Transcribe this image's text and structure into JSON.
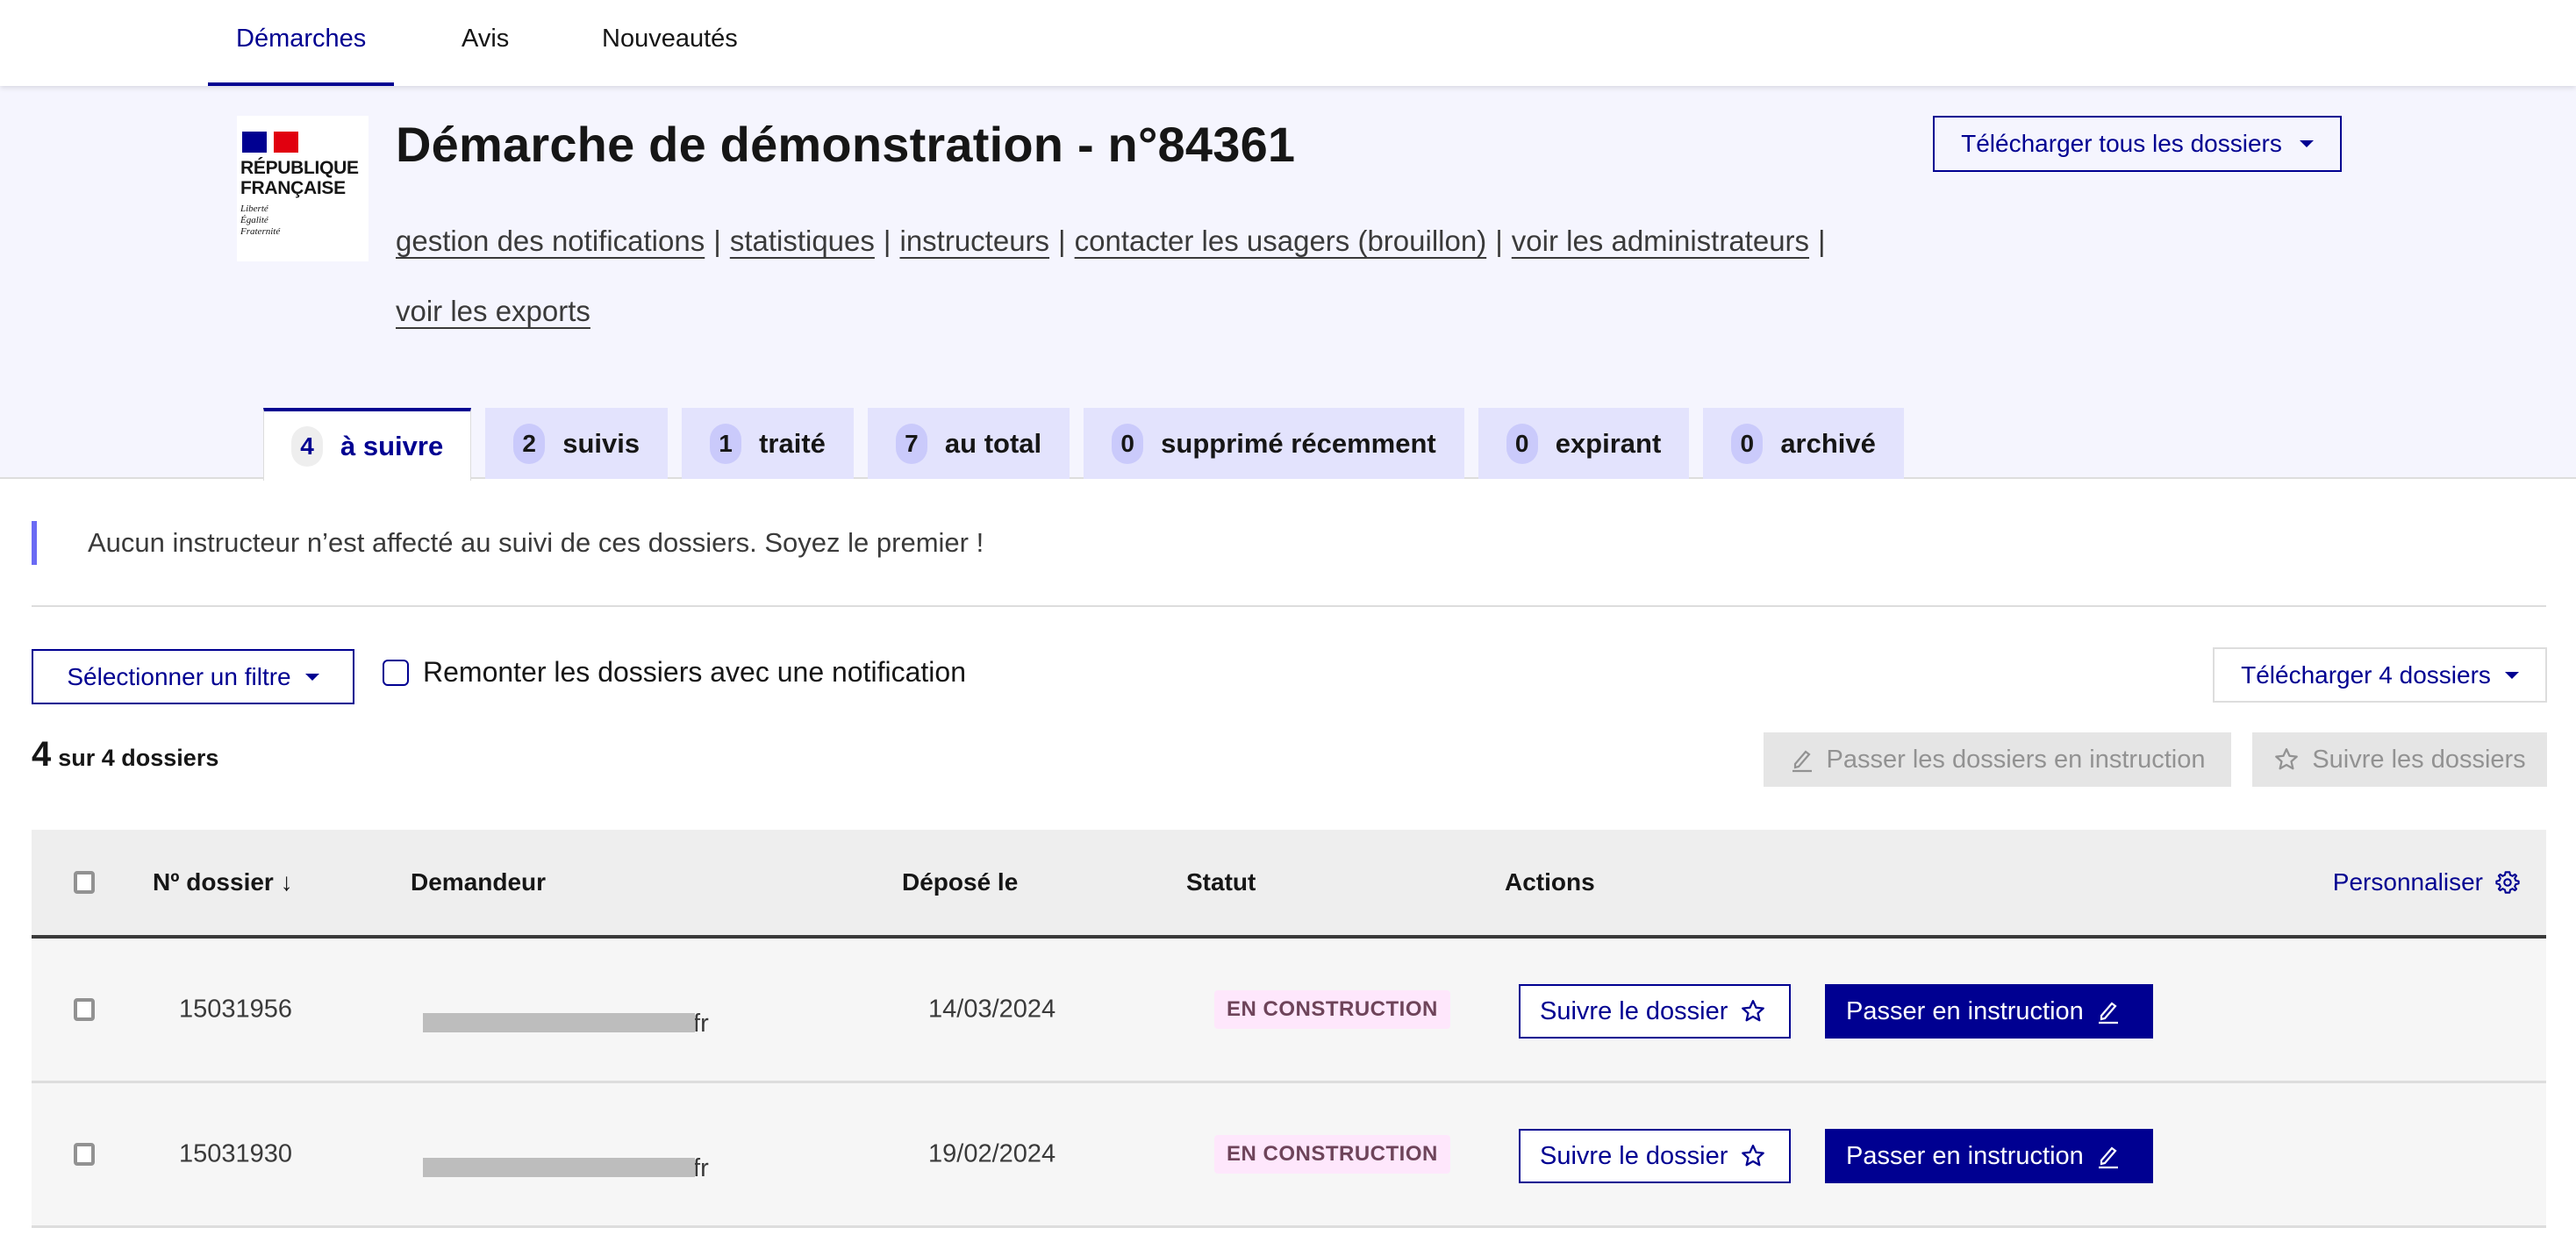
{
  "topnav": {
    "items": [
      {
        "label": "Démarches",
        "active": true
      },
      {
        "label": "Avis",
        "active": false
      },
      {
        "label": "Nouveautés",
        "active": false
      }
    ]
  },
  "header": {
    "logo": {
      "line1": "RÉPUBLIQUE",
      "line2": "FRANÇAISE",
      "motto1": "Liberté",
      "motto2": "Égalité",
      "motto3": "Fraternité"
    },
    "title": "Démarche de démonstration - n°84361",
    "download_all_label": "Télécharger tous les dossiers",
    "links": [
      "gestion des notifications",
      "statistiques",
      "instructeurs",
      "contacter les usagers (brouillon)",
      "voir les administrateurs",
      "voir les exports"
    ],
    "separator": "|"
  },
  "tabs": [
    {
      "count": "4",
      "label": "à suivre",
      "active": true
    },
    {
      "count": "2",
      "label": "suivis",
      "active": false
    },
    {
      "count": "1",
      "label": "traité",
      "active": false
    },
    {
      "count": "7",
      "label": "au total",
      "active": false
    },
    {
      "count": "0",
      "label": "supprimé récemment",
      "active": false
    },
    {
      "count": "0",
      "label": "expirant",
      "active": false
    },
    {
      "count": "0",
      "label": "archivé",
      "active": false
    }
  ],
  "notice": "Aucun instructeur n’est affecté au suivi de ces dossiers. Soyez le premier !",
  "filters": {
    "select_filter_label": "Sélectionner un filtre",
    "notification_checkbox_label": "Remonter les dossiers avec une notification",
    "notification_checked": false,
    "download_label": "Télécharger 4 dossiers"
  },
  "summary": {
    "count": "4",
    "text": "sur 4 dossiers"
  },
  "bulk_actions": {
    "instruct_label": "Passer les dossiers en instruction",
    "follow_label": "Suivre les dossiers"
  },
  "table": {
    "columns": {
      "number": "Nº dossier ↓",
      "applicant": "Demandeur",
      "date": "Déposé le",
      "status": "Statut",
      "actions": "Actions",
      "customize": "Personnaliser"
    },
    "rows": [
      {
        "number": "15031956",
        "applicant_visible": ".fr",
        "applicant_redacted": true,
        "date": "14/03/2024",
        "status": "EN CONSTRUCTION",
        "follow_label": "Suivre le dossier",
        "instruct_label": "Passer en instruction"
      },
      {
        "number": "15031930",
        "applicant_visible": ".fr",
        "applicant_redacted": true,
        "date": "19/02/2024",
        "status": "EN CONSTRUCTION",
        "follow_label": "Suivre le dossier",
        "instruct_label": "Passer en instruction"
      }
    ]
  },
  "colors": {
    "primary": "#000091",
    "header_bg": "#f5f5fe",
    "tab_bg": "#e3e3fd",
    "notice_bar": "#6a6af4",
    "badge_bg": "#fee7fc",
    "badge_text": "#6e445a"
  }
}
